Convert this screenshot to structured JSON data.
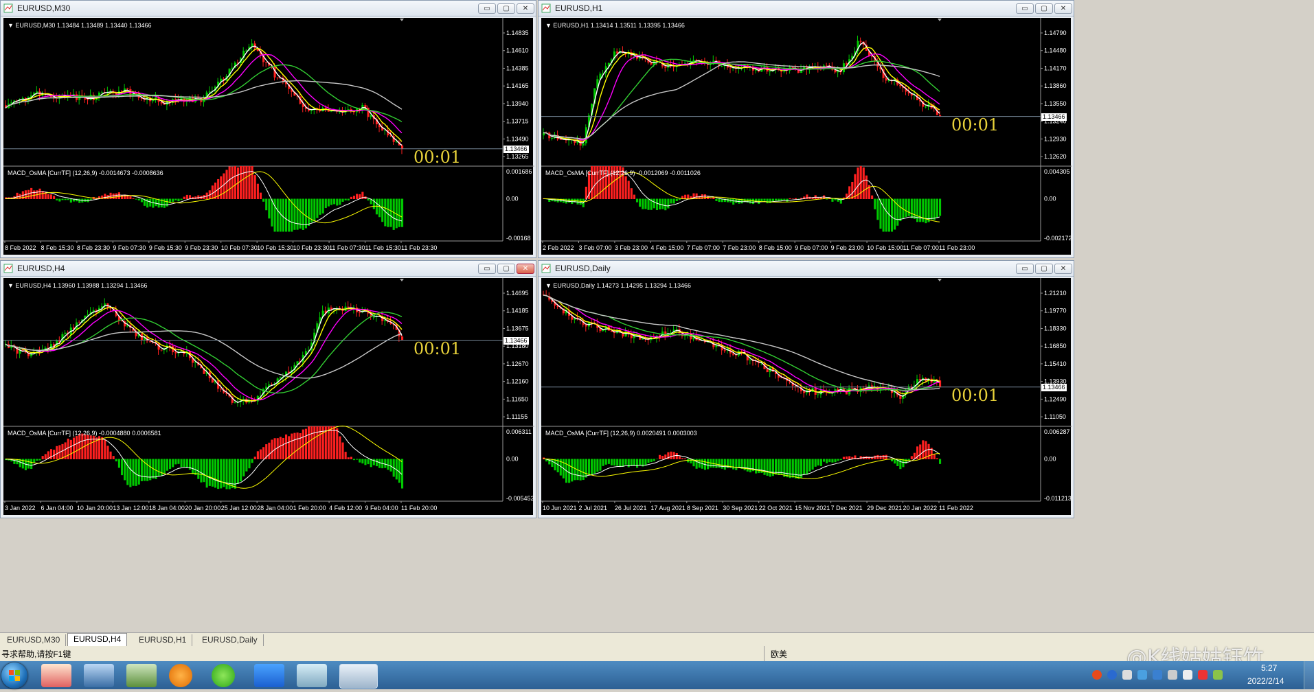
{
  "windows": [
    {
      "title": "EURUSD,M30",
      "info": "EURUSD,M30  1.13484 1.13489 1.13440 1.13466",
      "macd": "MACD_OsMA [CurrTF] (12,26,9) -0.0014673 -0.0008636",
      "prices": [
        "1.14835",
        "1.14610",
        "1.14385",
        "1.14165",
        "1.13940",
        "1.13715",
        "1.13490",
        "1.13265"
      ],
      "macd_levels": [
        "0.001686",
        "0.00",
        "-0.00168"
      ],
      "dates": [
        "8 Feb 2022",
        "8 Feb 15:30",
        "8 Feb 23:30",
        "9 Feb 07:30",
        "9 Feb 15:30",
        "9 Feb 23:30",
        "10 Feb 07:30",
        "10 Feb 15:30",
        "10 Feb 23:30",
        "11 Feb 07:30",
        "11 Feb 15:30",
        "11 Feb 23:30"
      ],
      "current_price": "1.13466",
      "timer": "00:01"
    },
    {
      "title": "EURUSD,H1",
      "info": "EURUSD,H1  1.13414 1.13511 1.13395 1.13466",
      "macd": "MACD_OsMA [CurrTF] (12,26,9) -0.0012069 -0.0011026",
      "prices": [
        "1.14790",
        "1.14480",
        "1.14170",
        "1.13860",
        "1.13550",
        "1.13240",
        "1.12930",
        "1.12620"
      ],
      "macd_levels": [
        "0.004305",
        "0.00",
        "-0.002172"
      ],
      "dates": [
        "2 Feb 2022",
        "3 Feb 07:00",
        "3 Feb 23:00",
        "4 Feb 15:00",
        "7 Feb 07:00",
        "7 Feb 23:00",
        "8 Feb 15:00",
        "9 Feb 07:00",
        "9 Feb 23:00",
        "10 Feb 15:00",
        "11 Feb 07:00",
        "11 Feb 23:00"
      ],
      "current_price": "1.13466",
      "timer": "00:01"
    },
    {
      "title": "EURUSD,H4",
      "info": "EURUSD,H4  1.13960 1.13988 1.13294 1.13466",
      "macd": "MACD_OsMA [CurrTF] (12,26,9) -0.0004880 0.0006581",
      "prices": [
        "1.14695",
        "1.14185",
        "1.13675",
        "1.13180",
        "1.12670",
        "1.12160",
        "1.11650",
        "1.11155"
      ],
      "macd_levels": [
        "0.006311",
        "0.00",
        "-0.005452"
      ],
      "dates": [
        "3 Jan 2022",
        "6 Jan 04:00",
        "10 Jan 20:00",
        "13 Jan 12:00",
        "18 Jan 04:00",
        "20 Jan 20:00",
        "25 Jan 12:00",
        "28 Jan 04:00",
        "1 Feb 20:00",
        "4 Feb 12:00",
        "9 Feb 04:00",
        "11 Feb 20:00"
      ],
      "current_price": "1.13466",
      "timer": "00:01"
    },
    {
      "title": "EURUSD,Daily",
      "info": "EURUSD,Daily  1.14273 1.14295 1.13294 1.13466",
      "macd": "MACD_OsMA [CurrTF] (12,26,9) 0.0020491 0.0003003",
      "prices": [
        "1.21210",
        "1.19770",
        "1.18330",
        "1.16850",
        "1.15410",
        "1.13930",
        "1.12490",
        "1.11050"
      ],
      "macd_levels": [
        "0.006287",
        "0.00",
        "-0.011213"
      ],
      "dates": [
        "10 Jun 2021",
        "2 Jul 2021",
        "26 Jul 2021",
        "17 Aug 2021",
        "8 Sep 2021",
        "30 Sep 2021",
        "22 Oct 2021",
        "15 Nov 2021",
        "7 Dec 2021",
        "29 Dec 2021",
        "20 Jan 2022",
        "11 Feb 2022"
      ],
      "current_price": "1.13466",
      "timer": "00:01"
    }
  ],
  "tabs": [
    "EURUSD,M30",
    "EURUSD,H4",
    "EURUSD,H1",
    "EURUSD,Daily"
  ],
  "status": {
    "help": "寻求帮助,请按F1键",
    "profile": "欧美",
    "watermark": "@K线姑姑钰竹"
  },
  "taskbar": {
    "time": "5:27",
    "date": "2022/2/14"
  },
  "colors": {
    "bull": "#00c800",
    "bear": "#ff2020",
    "ma_fast": "#ffffff",
    "ma_yellow": "#ffff00",
    "ma_magenta": "#ff00ff",
    "ma_green": "#32cd32",
    "ma_gray": "#c8c8c8",
    "timer": "#e8d23a"
  }
}
